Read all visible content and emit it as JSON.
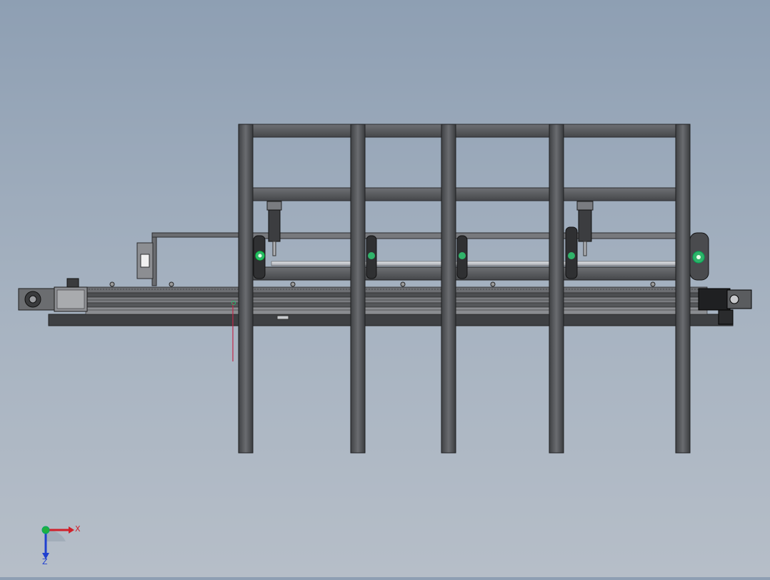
{
  "viewport": {
    "background_top": "#8e9fb3",
    "background_bottom": "#b6bec8"
  },
  "model": {
    "frame_color": "#55575a",
    "frame_edge": "#2b2c2e",
    "accent_green": "#2fb36a",
    "sketch_line_color": "#c0284a"
  },
  "triad": {
    "x_label": "X",
    "z_label": "Z",
    "x_color": "#d0202a",
    "y_color": "#20b040",
    "z_color": "#2040d0"
  }
}
